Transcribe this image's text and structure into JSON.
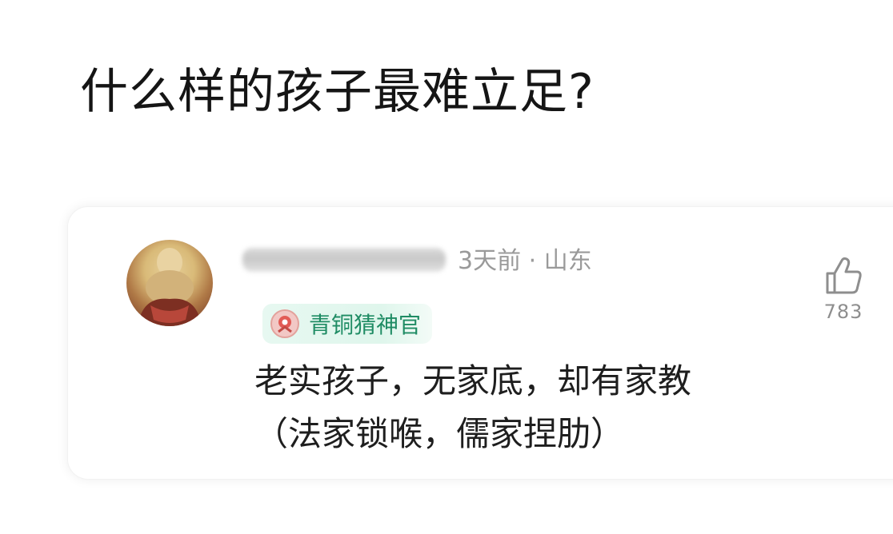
{
  "question": {
    "title": "什么样的孩子最难立足?"
  },
  "comment": {
    "meta": "3天前 · 山东",
    "badge_label": "青铜猜神官",
    "text_line1": "老实孩子，无家底，却有家教",
    "text_line2": "（法家锁喉，儒家捏肋）",
    "like_count": "783"
  },
  "icons": {
    "avatar": "avatar-image",
    "badge": "bronze-badge-icon",
    "like": "thumbs-up-icon"
  },
  "colors": {
    "badge_text": "#1f8c64",
    "badge_bg": "#e4f7ef",
    "meta_text": "#9a9a9a"
  }
}
